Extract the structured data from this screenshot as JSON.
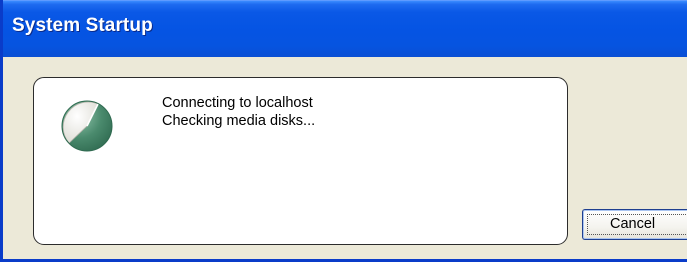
{
  "window": {
    "title": "System Startup"
  },
  "status": {
    "line1": "Connecting to localhost",
    "line2": "Checking media disks...",
    "icon": "progress-pie-icon"
  },
  "buttons": {
    "cancel_label": "Cancel"
  },
  "colors": {
    "titlebar": "#0554e3",
    "dialog_background": "#ece9d8",
    "pie_fill": "#4a8a6d",
    "pie_background": "#ecebe5"
  }
}
